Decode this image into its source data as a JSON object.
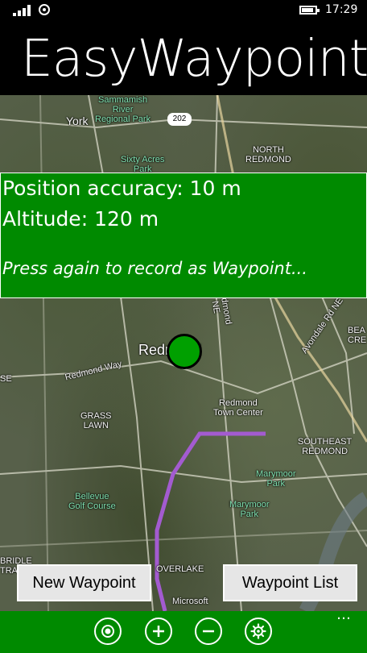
{
  "status_bar": {
    "time": "17:29"
  },
  "app": {
    "title": "EasyWaypoint"
  },
  "map": {
    "labels": {
      "york": "York",
      "sammamish": "Sammamish\nRiver\nRegional Park",
      "route_202": "202",
      "sixty_acres": "Sixty Acres\nPark",
      "north_redmond": "NORTH\nREDMOND",
      "redmond_ne": "Redmond\nNE",
      "avondale": "Avondale Rd NE",
      "beach": "BEA\nCRE",
      "redmond": "Redmond",
      "redmond_way": "Redmond Way",
      "se": "SE",
      "grass_lawn": "GRASS\nLAWN",
      "redmond_town_center": "Redmond\nTown Center",
      "southeast_redmond": "SOUTHEAST\nREDMOND",
      "marymoor": "Marymoor\nPark",
      "marymoor2": "Marymoor\nPark",
      "bellevue_golf": "Bellevue\nGolf Course",
      "overlake": "OVERLAKE",
      "bridle": "BRIDLE\nTRAILS",
      "microsoft": "Microsoft"
    }
  },
  "info": {
    "accuracy": "Position accuracy: 10 m",
    "altitude": "Altitude: 120 m",
    "hint": "Press again to record as Waypoint..."
  },
  "buttons": {
    "new_waypoint": "New Waypoint",
    "waypoint_list": "Waypoint List"
  },
  "app_bar": {
    "icons": [
      "locate-icon",
      "zoom-in-icon",
      "zoom-out-icon",
      "settings-icon"
    ],
    "more": "…"
  },
  "colors": {
    "accent": "#008a00",
    "route": "#a35bd0"
  }
}
